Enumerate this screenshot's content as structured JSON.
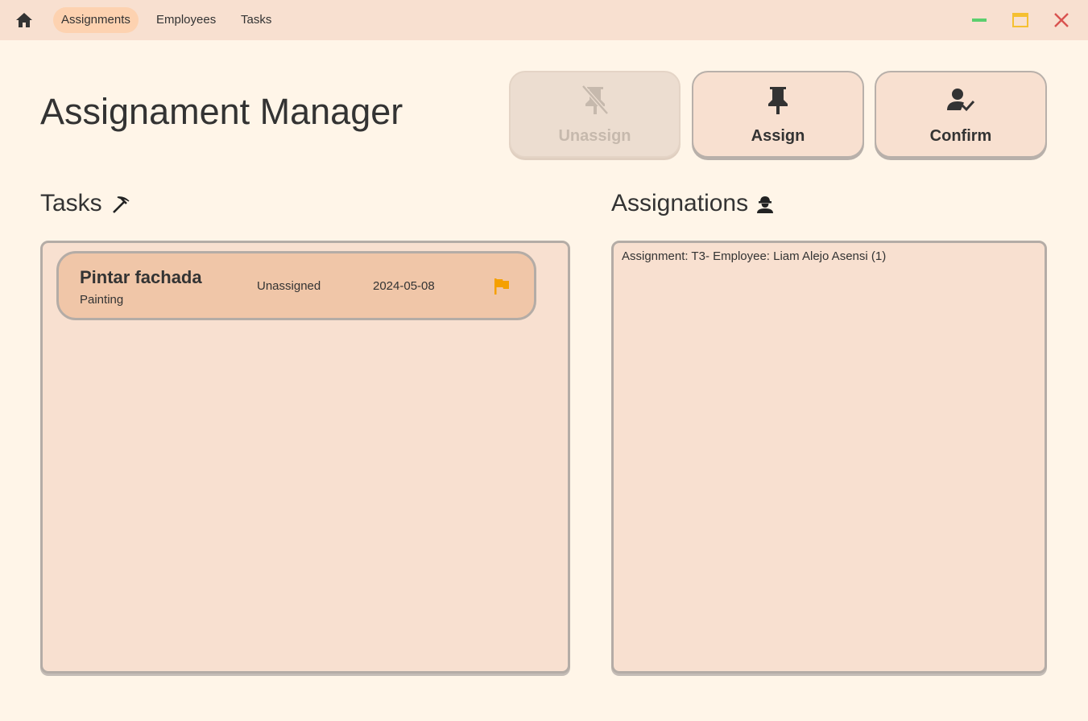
{
  "nav": {
    "items": [
      {
        "label": "Assignments",
        "active": true
      },
      {
        "label": "Employees",
        "active": false
      },
      {
        "label": "Tasks",
        "active": false
      }
    ],
    "home_icon": "home-icon"
  },
  "window_controls": {
    "minimize_color": "#5ccf6e",
    "maximize_color": "#f5c031",
    "close_color": "#d9534f"
  },
  "page": {
    "title": "Assignament Manager"
  },
  "actions": {
    "unassign_label": "Unassign",
    "unassign_enabled": false,
    "assign_label": "Assign",
    "confirm_label": "Confirm"
  },
  "tasks": {
    "title": "Tasks",
    "icon": "pickaxe-icon",
    "items": [
      {
        "name": "Pintar fachada",
        "category": "Painting",
        "status": "Unassigned",
        "date": "2024-05-08",
        "priority_icon": "flag-icon",
        "priority_color": "#f5a000"
      }
    ]
  },
  "assignations": {
    "title": "Assignations",
    "icon": "worker-icon",
    "items": [
      "Assignment: T3- Employee: Liam Alejo Asensi (1)"
    ]
  },
  "colors": {
    "background": "#fff5e8",
    "titlebar": "#f8e0d0",
    "active_nav": "#fdd2b0",
    "panel": "#f8e0d0",
    "card": "#f0c6a8"
  }
}
